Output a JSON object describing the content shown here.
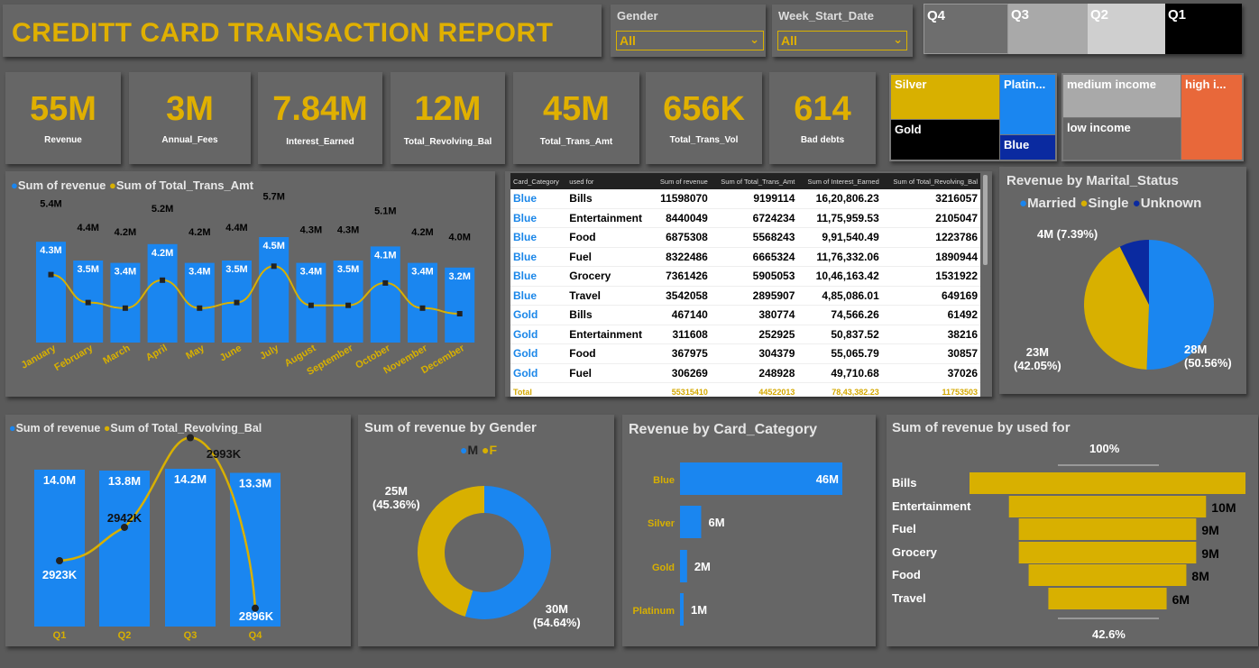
{
  "header": {
    "title": "CREDITT CARD TRANSACTION REPORT"
  },
  "slicers": {
    "gender": {
      "label": "Gender",
      "value": "All"
    },
    "week": {
      "label": "Week_Start_Date",
      "value": "All"
    }
  },
  "quarter_slicer": [
    "Q4",
    "Q3",
    "Q2",
    "Q1"
  ],
  "kpis": [
    {
      "value": "55M",
      "label": "Revenue"
    },
    {
      "value": "3M",
      "label": "Annual_Fees"
    },
    {
      "value": "7.84M",
      "label": "Interest_Earned"
    },
    {
      "value": "12M",
      "label": "Total_Revolving_Bal"
    },
    {
      "value": "45M",
      "label": "Total_Trans_Amt"
    },
    {
      "value": "656K",
      "label": "Total_Trans_Vol"
    },
    {
      "value": "614",
      "label": "Bad debts"
    }
  ],
  "card_treemap": {
    "silver": "Silver",
    "platinum": "Platin...",
    "gold": "Gold",
    "blue": "Blue"
  },
  "income_treemap": {
    "medium": "medium income",
    "high": "high i...",
    "low": "low income"
  },
  "colors": {
    "blue": "#1a86f0",
    "gold": "#d8b000",
    "navy": "#0a2aa0",
    "orange": "#e8683a",
    "black": "#000000"
  },
  "monthly_chart": {
    "legend": [
      "Sum of revenue",
      "Sum of Total_Trans_Amt"
    ],
    "months": [
      "January",
      "February",
      "March",
      "April",
      "May",
      "June",
      "July",
      "August",
      "September",
      "October",
      "November",
      "December"
    ],
    "revenue_labels": [
      "5.4M",
      "4.4M",
      "4.2M",
      "5.2M",
      "4.2M",
      "4.4M",
      "5.7M",
      "4.3M",
      "4.3M",
      "5.1M",
      "4.2M",
      "4.0M"
    ],
    "trans_labels": [
      "4.3M",
      "3.5M",
      "3.4M",
      "4.2M",
      "3.4M",
      "3.5M",
      "4.5M",
      "3.4M",
      "3.5M",
      "4.1M",
      "3.4M",
      "3.2M"
    ]
  },
  "chart_data": [
    {
      "type": "bar",
      "categories": [
        "January",
        "February",
        "March",
        "April",
        "May",
        "June",
        "July",
        "August",
        "September",
        "October",
        "November",
        "December"
      ],
      "series": [
        {
          "name": "Sum of revenue",
          "values": [
            5.4,
            4.4,
            4.2,
            5.2,
            4.2,
            4.4,
            5.7,
            4.3,
            4.3,
            5.1,
            4.2,
            4.0
          ]
        },
        {
          "name": "Sum of Total_Trans_Amt",
          "values": [
            4.3,
            3.5,
            3.4,
            4.2,
            3.4,
            3.5,
            4.5,
            3.4,
            3.5,
            4.1,
            3.4,
            3.2
          ]
        }
      ]
    },
    {
      "type": "bar",
      "categories": [
        "Q1",
        "Q2",
        "Q3",
        "Q4"
      ],
      "series": [
        {
          "name": "Sum of revenue",
          "values": [
            14.0,
            13.8,
            14.2,
            13.3
          ]
        },
        {
          "name": "Sum of Total_Revolving_Bal",
          "values": [
            2923,
            2942,
            2993,
            2896
          ]
        }
      ]
    },
    {
      "type": "pie",
      "title": "Revenue by Marital_Status",
      "categories": [
        "Married",
        "Single",
        "Unknown"
      ],
      "values": [
        28,
        23,
        4
      ],
      "percent": [
        50.56,
        42.05,
        7.39
      ]
    },
    {
      "type": "pie",
      "title": "Sum of revenue by Gender",
      "categories": [
        "M",
        "F"
      ],
      "values": [
        30,
        25
      ],
      "percent": [
        54.64,
        45.36
      ]
    },
    {
      "type": "bar",
      "title": "Revenue by Card_Category",
      "categories": [
        "Blue",
        "Silver",
        "Gold",
        "Platinum"
      ],
      "values": [
        46,
        6,
        2,
        1
      ]
    },
    {
      "type": "bar",
      "title": "Sum of revenue by used for",
      "categories": [
        "Bills",
        "Entertainment",
        "Fuel",
        "Grocery",
        "Food",
        "Travel"
      ],
      "values": [
        14,
        10,
        9,
        9,
        8,
        6
      ]
    }
  ],
  "quarter_chart": {
    "legend": [
      "Sum of revenue",
      "Sum of Total_Revolving_Bal"
    ],
    "quarters": [
      "Q1",
      "Q2",
      "Q3",
      "Q4"
    ],
    "revenue_labels": [
      "14.0M",
      "13.8M",
      "14.2M",
      "13.3M"
    ],
    "bal_labels": [
      "2923K",
      "2942K",
      "2993K",
      "2896K"
    ]
  },
  "table": {
    "headers": [
      "Card_Category",
      "used for",
      "Sum of revenue",
      "Sum of Total_Trans_Amt",
      "Sum of Interest_Earned",
      "Sum of Total_Revolving_Bal"
    ],
    "rows": [
      [
        "Blue",
        "Bills",
        "11598070",
        "9199114",
        "16,20,806.23",
        "3216057"
      ],
      [
        "Blue",
        "Entertainment",
        "8440049",
        "6724234",
        "11,75,959.53",
        "2105047"
      ],
      [
        "Blue",
        "Food",
        "6875308",
        "5568243",
        "9,91,540.49",
        "1223786"
      ],
      [
        "Blue",
        "Fuel",
        "8322486",
        "6665324",
        "11,76,332.06",
        "1890944"
      ],
      [
        "Blue",
        "Grocery",
        "7361426",
        "5905053",
        "10,46,163.42",
        "1531922"
      ],
      [
        "Blue",
        "Travel",
        "3542058",
        "2895907",
        "4,85,086.01",
        "649169"
      ],
      [
        "Gold",
        "Bills",
        "467140",
        "380774",
        "74,566.26",
        "61492"
      ],
      [
        "Gold",
        "Entertainment",
        "311608",
        "252925",
        "50,837.52",
        "38216"
      ],
      [
        "Gold",
        "Food",
        "367975",
        "304379",
        "55,065.79",
        "30857"
      ],
      [
        "Gold",
        "Fuel",
        "306269",
        "248928",
        "49,710.68",
        "37026"
      ]
    ],
    "total": [
      "Total",
      "",
      "55315410",
      "44522013",
      "78,43,382.23",
      "11753503"
    ]
  },
  "marital": {
    "title": "Revenue by Marital_Status",
    "legend": [
      "Married",
      "Single",
      "Unknown"
    ],
    "labels": [
      {
        "v": "28M",
        "p": "(50.56%)"
      },
      {
        "v": "23M",
        "p": "(42.05%)"
      },
      {
        "v": "4M (7.39%)"
      }
    ]
  },
  "gender_chart": {
    "title": "Sum of revenue by Gender",
    "legend": [
      "M",
      "F"
    ],
    "m_label": {
      "v": "30M",
      "p": "(54.64%)"
    },
    "f_label": {
      "v": "25M",
      "p": "(45.36%)"
    }
  },
  "card_chart": {
    "title": "Revenue by Card_Category",
    "categories": [
      "Blue",
      "Silver",
      "Gold",
      "Platinum"
    ],
    "labels": [
      "46M",
      "6M",
      "2M",
      "1M"
    ]
  },
  "usedfor_chart": {
    "title": "Sum of revenue by used for",
    "top": "100%",
    "bottom": "42.6%",
    "categories": [
      "Bills",
      "Entertainment",
      "Fuel",
      "Grocery",
      "Food",
      "Travel"
    ],
    "labels": [
      "",
      "10M",
      "9M",
      "9M",
      "8M",
      "6M"
    ]
  }
}
